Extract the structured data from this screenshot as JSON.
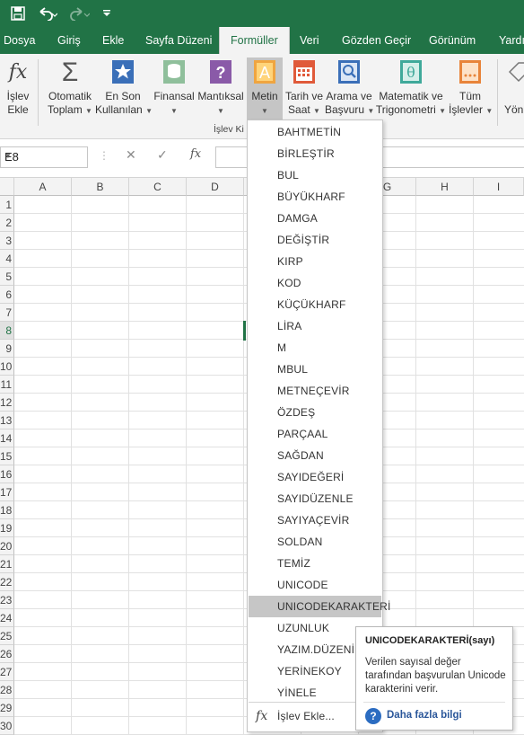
{
  "title_bar": {
    "icons": [
      "save-icon",
      "undo-icon",
      "redo-icon",
      "customize-icon"
    ]
  },
  "tabs": [
    "Dosya",
    "Giriş",
    "Ekle",
    "Sayfa Düzeni",
    "Formüller",
    "Veri",
    "Gözden Geçir",
    "Görünüm",
    "Yardı"
  ],
  "active_tab": "Formüller",
  "ribbon": {
    "insert_function": [
      "İşlev",
      "Ekle"
    ],
    "autosum": [
      "Otomatik",
      "Toplam"
    ],
    "recent": [
      "En Son",
      "Kullanılan"
    ],
    "financial": "Finansal",
    "logical": "Mantıksal",
    "text": "Metin",
    "datetime": [
      "Tarih ve",
      "Saat"
    ],
    "lookup": [
      "Arama ve",
      "Başvuru"
    ],
    "math": [
      "Matematik ve",
      "Trigonometri"
    ],
    "more": [
      "Tüm",
      "İşlevler"
    ],
    "partial_right": "Yön",
    "group_label": "İşlev Ki"
  },
  "formula_bar": {
    "name_box": "E8",
    "cancel": "✕",
    "enter": "✓",
    "fx": "fx"
  },
  "columns": [
    "A",
    "B",
    "C",
    "D",
    "E",
    "F",
    "G",
    "H",
    "I"
  ],
  "rows": [
    "1",
    "2",
    "3",
    "4",
    "5",
    "6",
    "7",
    "8",
    "9",
    "10",
    "11",
    "12",
    "13",
    "14",
    "15",
    "16",
    "17",
    "18",
    "19",
    "20",
    "21",
    "22",
    "23",
    "24",
    "25",
    "26",
    "27",
    "28",
    "29",
    "30"
  ],
  "selected_row": "8",
  "menu": {
    "items": [
      "BAHTMETİN",
      "BİRLEŞTİR",
      "BUL",
      "BÜYÜKHARF",
      "DAMGA",
      "DEĞİŞTİR",
      "KIRP",
      "KOD",
      "KÜÇÜKHARF",
      "LİRA",
      "M",
      "MBUL",
      "METNEÇEVİR",
      "ÖZDEŞ",
      "PARÇAAL",
      "SAĞDAN",
      "SAYIDEĞERİ",
      "SAYIDÜZENLE",
      "SAYIYAÇEVİR",
      "SOLDAN",
      "TEMİZ",
      "UNICODE",
      "UNICODEKARAKTERİ",
      "UZUNLUK",
      "YAZIM.DÜZENİ",
      "YERİNEKOY",
      "YİNELE"
    ],
    "highlighted": "UNICODEKARAKTERİ",
    "insert_function": "İşlev Ekle..."
  },
  "tooltip": {
    "title": "UNICODEKARAKTERİ(sayı)",
    "description": "Verilen sayısal değer tarafından başvurulan Unicode karakterini verir.",
    "more_info": "Daha fazla bilgi"
  }
}
